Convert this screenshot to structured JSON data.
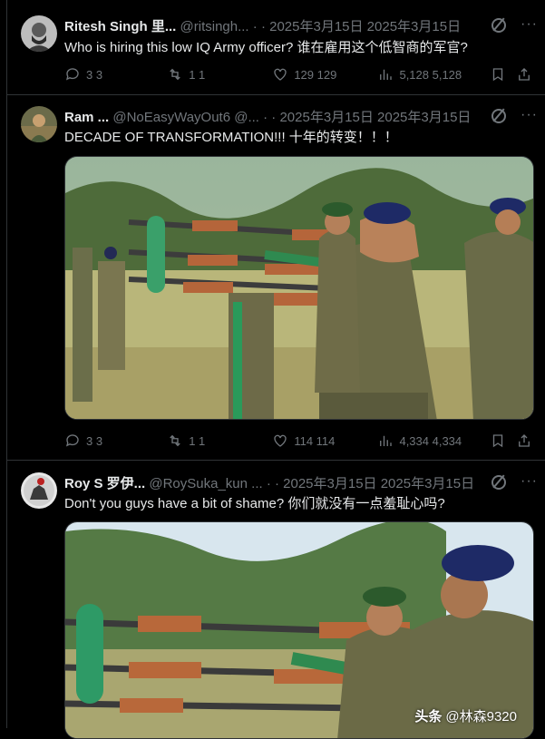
{
  "posts": [
    {
      "name": "Ritesh Singh 里...",
      "handle": "@ritsingh...",
      "meta": "· · 2025年3月15日 2025年3月15日",
      "text": "Who is hiring this low IQ Army officer? 谁在雇用这个低智商的军官?",
      "replies": "3 3",
      "reposts": "1 1",
      "likes": "129 129",
      "views": "5,128 5,128",
      "avatar_icon": "bearded-man-avatar"
    },
    {
      "name": "Ram ...",
      "handle": "@NoEasyWayOut6 @...",
      "meta": "· · 2025年3月15日 2025年3月15日",
      "text": "DECADE OF TRANSFORMATION!!! 十年的转变！！！",
      "replies": "3 3",
      "reposts": "1 1",
      "likes": "114 114",
      "views": "4,334 4,334",
      "avatar_icon": "soldier-avatar",
      "media": "photo of officers inspecting rifles on a rack"
    },
    {
      "name": "Roy S 罗伊...",
      "handle": "@RoySuka_kun ...",
      "meta": "· · 2025年3月15日 2025年3月15日",
      "text": "Don't you guys have a bit of shame? 你们就没有一点羞耻心吗?",
      "avatar_icon": "horse-rider-avatar",
      "media": "close-up photo of officer holding rifle"
    }
  ],
  "watermark": {
    "brand": "头条",
    "user": "@林森9320"
  },
  "colors": {
    "background": "#000000",
    "text": "#e7e9ea",
    "muted": "#71767b",
    "border": "#2f3336"
  }
}
